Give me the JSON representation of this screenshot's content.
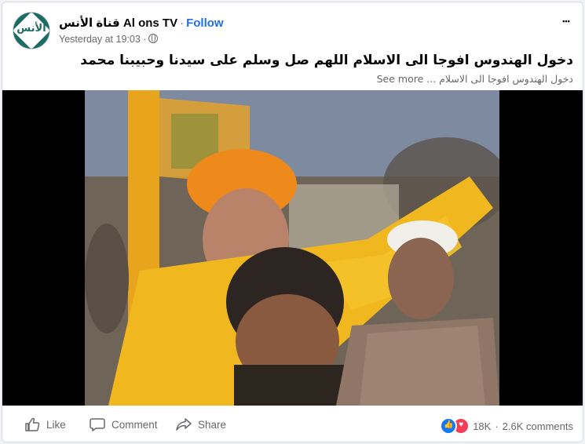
{
  "post": {
    "page_name": "قناة الأنس Al ons TV",
    "separator": "·",
    "follow_label": "Follow",
    "timestamp": "Yesterday at 19:03 ·",
    "avatar_text": "الأنس",
    "more_label": "•••",
    "caption": "دخول الهندوس افوجا الى الاسلام اللهم صل وسلم على سيدنا وحبيبنا محمد",
    "subcaption": "دخول الهندوس افوجا الى الاسلام ...",
    "see_more_label": "See more"
  },
  "actions": {
    "like_label": "Like",
    "comment_label": "Comment",
    "share_label": "Share"
  },
  "stats": {
    "reactions_count": "18K",
    "comments_count": "2.6K comments"
  },
  "colors": {
    "accent": "#216fdb",
    "like_blue": "#1877f2",
    "love_red": "#f33e58",
    "saffron": "#f0a21e",
    "avatar_green": "#1d6b62"
  },
  "icons": {
    "globe": "globe-icon",
    "more": "more-icon",
    "like": "like-icon",
    "comment": "comment-icon",
    "share": "share-icon"
  }
}
